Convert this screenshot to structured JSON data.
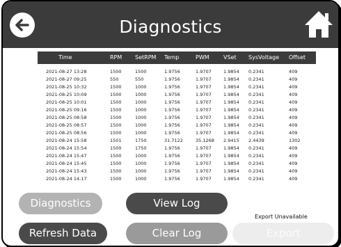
{
  "header": {
    "title": "Diagnostics",
    "back_icon": "arrow-left-icon",
    "home_icon": "home-icon"
  },
  "table": {
    "columns": [
      "Time",
      "RPM",
      "SetRPM",
      "Temp",
      "PWM",
      "VSet",
      "SysVoltage",
      "Offset"
    ],
    "rows": [
      [
        "2021-08-27 13:28",
        "1500",
        "1500",
        "1.9756",
        "1.9707",
        "1.9854",
        "0.2341",
        "409"
      ],
      [
        "2021-08-27 09:25",
        "550",
        "550",
        "1.9756",
        "1.9707",
        "1.9854",
        "0.2341",
        "409"
      ],
      [
        "2021-08-25 10:32",
        "1500",
        "1000",
        "1.9756",
        "1.9707",
        "1.9854",
        "0.2341",
        "409"
      ],
      [
        "2021-08-25 10:09",
        "1500",
        "1000",
        "1.9756",
        "1.9707",
        "1.9854",
        "0.2341",
        "409"
      ],
      [
        "2021-08-25 10:01",
        "1500",
        "1000",
        "1.9756",
        "1.9707",
        "1.9854",
        "0.2341",
        "409"
      ],
      [
        "2021-08-25 09:16",
        "1500",
        "1000",
        "1.9756",
        "1.9707",
        "1.9854",
        "0.2341",
        "409"
      ],
      [
        "2021-08-25 08:58",
        "1500",
        "1000",
        "1.9756",
        "1.9707",
        "1.9854",
        "0.2341",
        "409"
      ],
      [
        "2021-08-25 08:57",
        "1500",
        "1000",
        "1.9756",
        "1.9707",
        "1.9854",
        "0.2341",
        "409"
      ],
      [
        "2021-08-25 08:56",
        "1500",
        "1000",
        "1.9756",
        "1.9707",
        "1.9854",
        "0.2341",
        "409"
      ],
      [
        "2021-08-24 15:58",
        "1501",
        "1750",
        "31.7122",
        "35.1268",
        "2.9415",
        "2.4439",
        "1302"
      ],
      [
        "2021-08-24 15:54",
        "1500",
        "1750",
        "1.9756",
        "1.9707",
        "1.9854",
        "0.2341",
        "409"
      ],
      [
        "2021-08-24 15:47",
        "1500",
        "1000",
        "1.9756",
        "1.9707",
        "1.9854",
        "0.2341",
        "409"
      ],
      [
        "2021-08-24 15:45",
        "1500",
        "1000",
        "1.9756",
        "1.9707",
        "1.9854",
        "0.2341",
        "409"
      ],
      [
        "2021-08-24 15:43",
        "1500",
        "1000",
        "1.9756",
        "1.9707",
        "1.9854",
        "0.2341",
        "409"
      ],
      [
        "2021-08-24 14:17",
        "1500",
        "1000",
        "1.9756",
        "1.9707",
        "1.9854",
        "0.2341",
        "409"
      ]
    ]
  },
  "buttons": {
    "diagnostics": "Diagnostics",
    "view_log": "View Log",
    "refresh_data": "Refresh Data",
    "clear_log": "Clear Log",
    "export": "Export"
  },
  "export_status": "Export Unavailable",
  "colors": {
    "header_bg": "#3b3b3b",
    "button_dark": "#4a4a4a",
    "button_light": "#b3b3b3",
    "button_mid": "#9a9a9a",
    "button_disabled": "#ededed"
  }
}
